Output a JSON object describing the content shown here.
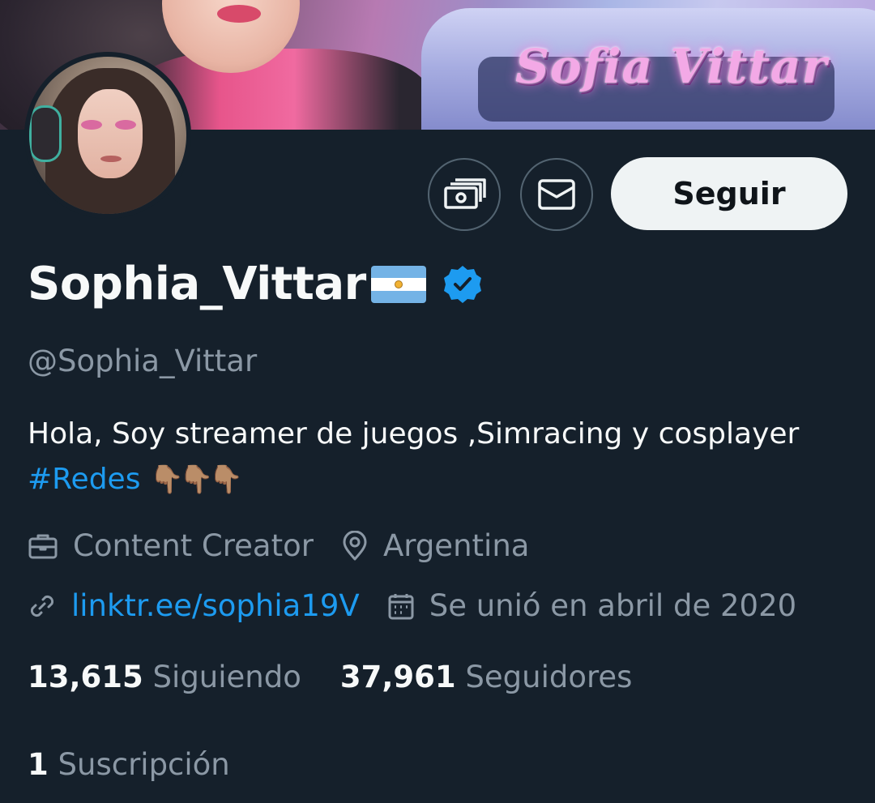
{
  "banner": {
    "brand_text": "Sofia Vittar"
  },
  "profile": {
    "display_name": "Sophia_Vittar",
    "flag_emoji": "🇦🇷",
    "verified": true,
    "handle": "@Sophia_Vittar",
    "bio": {
      "text": "Hola, Soy streamer de juegos ,Simracing y cosplayer",
      "hashtag": "#Redes",
      "emoji": "👇🏽👇🏽👇🏽"
    },
    "category": "Content Creator",
    "location": "Argentina",
    "website": "linktr.ee/sophia19V",
    "joined": "Se unió en abril de 2020"
  },
  "actions": {
    "tip_icon": "money-icon",
    "message_icon": "envelope-icon",
    "follow_label": "Seguir"
  },
  "stats": {
    "following_count": "13,615",
    "following_label": "Siguiendo",
    "followers_count": "37,961",
    "followers_label": "Seguidores",
    "subscriptions_count": "1",
    "subscriptions_label": "Suscripción"
  },
  "colors": {
    "background": "#15202b",
    "accent": "#1d9bf0",
    "secondary_text": "#8b98a5",
    "primary_text": "#f7f9f9"
  }
}
